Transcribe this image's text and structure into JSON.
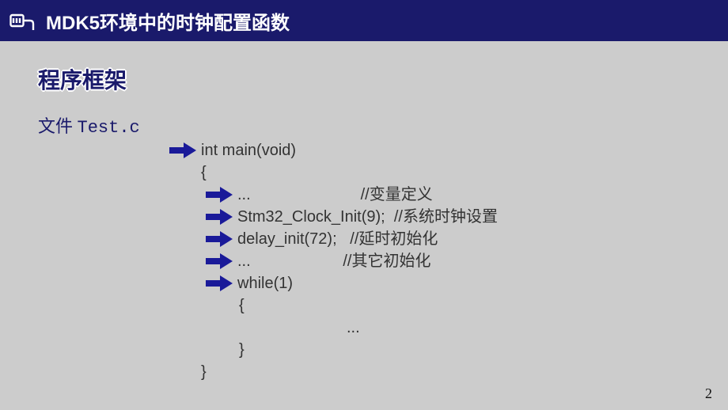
{
  "title": "MDK5环境中的时钟配置函数",
  "subtitle": "程序框架",
  "file_prefix": "文件 ",
  "file_name": "Test.c",
  "code": {
    "l1": "int main(void)",
    "l2": "{",
    "l3": "...                         //变量定义",
    "l4": "Stm32_Clock_Init(9);  //系统时钟设置",
    "l5": "delay_init(72);   //延时初始化",
    "l6": "...                     //其它初始化",
    "l7": "while(1)",
    "l8": "{",
    "l9": "...",
    "l10": "}",
    "l11": "}"
  },
  "page_number": "2"
}
